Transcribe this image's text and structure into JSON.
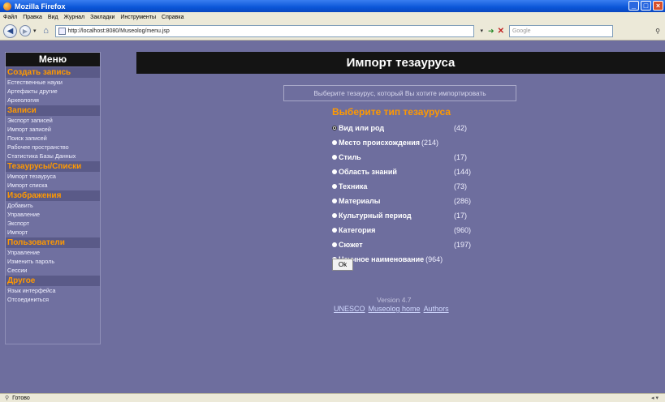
{
  "window": {
    "title": "Mozilla Firefox"
  },
  "menubar": [
    "Файл",
    "Правка",
    "Вид",
    "Журнал",
    "Закладки",
    "Инструменты",
    "Справка"
  ],
  "navbar": {
    "url": "http://localhost:8080/Museolog/menu.jsp",
    "search_placeholder": "Google"
  },
  "sidebar": {
    "title": "Меню",
    "sections": [
      {
        "header": "Создать запись",
        "items": [
          "Естественные науки",
          "Артефакты другие",
          "Археология"
        ]
      },
      {
        "header": "Записи",
        "items": [
          "Экспорт записей",
          "Импорт записей",
          "Поиск записей",
          "Рабочее пространство",
          "Статистика Базы Данных"
        ]
      },
      {
        "header": "Тезаурусы/Списки",
        "items": [
          "Импорт тезауруса",
          "Импорт списка"
        ]
      },
      {
        "header": "Изображения",
        "items": [
          "Добавить",
          "Управление",
          "Экспорт",
          "Импорт"
        ]
      },
      {
        "header": "Пользователи",
        "items": [
          "Управление",
          "Изменить пароль",
          "Сессии"
        ]
      },
      {
        "header": "Другое",
        "items": [
          "Язык интерфейса",
          "Отсоединиться"
        ]
      }
    ]
  },
  "main": {
    "page_title": "Импорт тезауруса",
    "prompt": "Выберите тезаурус, который Вы хотите импортировать",
    "type_title": "Выберите тип тезауруса",
    "options": [
      {
        "label": "Вид или род",
        "count": "(42)",
        "checked": true
      },
      {
        "label": "Место происхождения",
        "count": "(214)"
      },
      {
        "label": "Стиль",
        "count": "(17)"
      },
      {
        "label": "Область знаний",
        "count": "(144)"
      },
      {
        "label": "Техника",
        "count": "(73)"
      },
      {
        "label": "Материалы",
        "count": "(286)"
      },
      {
        "label": "Культурный период",
        "count": "(17)"
      },
      {
        "label": "Категория",
        "count": "(960)"
      },
      {
        "label": "Сюжет",
        "count": "(197)"
      },
      {
        "label": "Научное наименование",
        "count": "(964)"
      }
    ],
    "ok_label": "Ok",
    "version": "Version 4.7",
    "links": [
      "UNESCO",
      "Museolog home",
      "Authors"
    ]
  },
  "statusbar": {
    "text": "Готово"
  },
  "colors": {
    "background": "#6e6e9e",
    "accent": "#ff9900",
    "header_bg": "#141414"
  }
}
